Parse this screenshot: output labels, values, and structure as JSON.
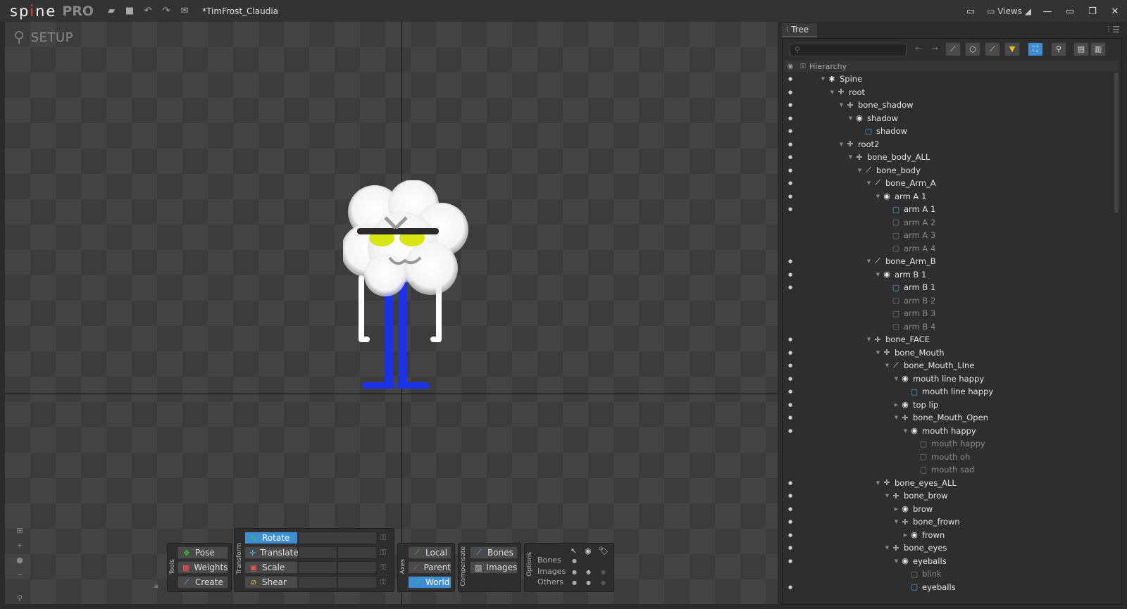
{
  "app": {
    "logo_left": "sp",
    "logo_dot": "i",
    "logo_right": "ne",
    "logo_edition": "PRO",
    "document_title": "*TimFrost_Claudia",
    "views_label": "Views"
  },
  "viewport": {
    "mode_label": "SETUP"
  },
  "tools": {
    "label": "Tools",
    "pose": "Pose",
    "weights": "Weights",
    "create": "Create"
  },
  "transform": {
    "label": "Transform",
    "rotate": "Rotate",
    "translate": "Translate",
    "scale": "Scale",
    "shear": "Shear"
  },
  "axes": {
    "label": "Axes",
    "local": "Local",
    "parent": "Parent",
    "world": "World"
  },
  "compensate": {
    "label": "Compensate",
    "bones": "Bones",
    "images": "Images"
  },
  "options": {
    "label": "Options",
    "bones": "Bones",
    "images": "Images",
    "others": "Others"
  },
  "tree": {
    "tab_label": "Tree",
    "hierarchy_label": "Hierarchy",
    "colors": {
      "bone": "#e8e8e8",
      "slot": "#e8e8e8",
      "attachment_on": "#4aa8d8",
      "attachment_off": "#7a7a7a"
    },
    "rows": [
      {
        "label": "Spine",
        "depth": 0,
        "icon": "skeleton",
        "open": true,
        "dim": false
      },
      {
        "label": "root",
        "depth": 1,
        "icon": "bone",
        "open": true,
        "dim": false
      },
      {
        "label": "bone_shadow",
        "depth": 2,
        "icon": "bone",
        "open": true,
        "dim": false
      },
      {
        "label": "shadow",
        "depth": 3,
        "icon": "slot",
        "open": true,
        "dim": false
      },
      {
        "label": "shadow",
        "depth": 4,
        "icon": "image",
        "open": null,
        "dim": false
      },
      {
        "label": "root2",
        "depth": 2,
        "icon": "bone",
        "open": true,
        "dim": false
      },
      {
        "label": "bone_body_ALL",
        "depth": 3,
        "icon": "bone",
        "open": true,
        "dim": false
      },
      {
        "label": "bone_body",
        "depth": 4,
        "icon": "pen",
        "open": true,
        "dim": false
      },
      {
        "label": "bone_Arm_A",
        "depth": 5,
        "icon": "pen",
        "open": true,
        "dim": false
      },
      {
        "label": "arm A 1",
        "depth": 6,
        "icon": "slot",
        "open": true,
        "dim": false
      },
      {
        "label": "arm A 1",
        "depth": 7,
        "icon": "image",
        "open": null,
        "dim": false
      },
      {
        "label": "arm A 2",
        "depth": 7,
        "icon": "image",
        "open": null,
        "dim": true
      },
      {
        "label": "arm A 3",
        "depth": 7,
        "icon": "image",
        "open": null,
        "dim": true
      },
      {
        "label": "arm A 4",
        "depth": 7,
        "icon": "image",
        "open": null,
        "dim": true
      },
      {
        "label": "bone_Arm_B",
        "depth": 5,
        "icon": "pen",
        "open": true,
        "dim": false
      },
      {
        "label": "arm B 1",
        "depth": 6,
        "icon": "slot",
        "open": true,
        "dim": false
      },
      {
        "label": "arm B 1",
        "depth": 7,
        "icon": "image",
        "open": null,
        "dim": false
      },
      {
        "label": "arm B 2",
        "depth": 7,
        "icon": "image",
        "open": null,
        "dim": true
      },
      {
        "label": "arm B 3",
        "depth": 7,
        "icon": "image",
        "open": null,
        "dim": true
      },
      {
        "label": "arm B 4",
        "depth": 7,
        "icon": "image",
        "open": null,
        "dim": true
      },
      {
        "label": "bone_FACE",
        "depth": 5,
        "icon": "bone",
        "open": true,
        "dim": false
      },
      {
        "label": "bone_Mouth",
        "depth": 6,
        "icon": "bone",
        "open": true,
        "dim": false
      },
      {
        "label": "bone_Mouth_LIne",
        "depth": 7,
        "icon": "pen",
        "open": true,
        "dim": false
      },
      {
        "label": "mouth line happy",
        "depth": 8,
        "icon": "slot",
        "open": true,
        "dim": false
      },
      {
        "label": "mouth line happy",
        "depth": 9,
        "icon": "image",
        "open": null,
        "dim": false
      },
      {
        "label": "top lip",
        "depth": 8,
        "icon": "slot",
        "open": false,
        "dim": false
      },
      {
        "label": "bone_Mouth_Open",
        "depth": 8,
        "icon": "bone",
        "open": true,
        "dim": false
      },
      {
        "label": "mouth happy",
        "depth": 9,
        "icon": "slot",
        "open": true,
        "dim": false
      },
      {
        "label": "mouth happy",
        "depth": 10,
        "icon": "image",
        "open": null,
        "dim": true
      },
      {
        "label": "mouth oh",
        "depth": 10,
        "icon": "image",
        "open": null,
        "dim": true
      },
      {
        "label": "mouth sad",
        "depth": 10,
        "icon": "image",
        "open": null,
        "dim": true
      },
      {
        "label": "bone_eyes_ALL",
        "depth": 6,
        "icon": "bone",
        "open": true,
        "dim": false
      },
      {
        "label": "bone_brow",
        "depth": 7,
        "icon": "bone",
        "open": true,
        "dim": false
      },
      {
        "label": "brow",
        "depth": 8,
        "icon": "slot",
        "open": false,
        "dim": false
      },
      {
        "label": "bone_frown",
        "depth": 8,
        "icon": "bone",
        "open": true,
        "dim": false
      },
      {
        "label": "frown",
        "depth": 9,
        "icon": "slot",
        "open": false,
        "dim": false
      },
      {
        "label": "bone_eyes",
        "depth": 7,
        "icon": "bone",
        "open": true,
        "dim": false
      },
      {
        "label": "eyeballs",
        "depth": 8,
        "icon": "slot",
        "open": true,
        "dim": false
      },
      {
        "label": "blink",
        "depth": 9,
        "icon": "image",
        "open": null,
        "dim": true
      },
      {
        "label": "eyeballs",
        "depth": 9,
        "icon": "image",
        "open": null,
        "dim": false
      }
    ]
  }
}
